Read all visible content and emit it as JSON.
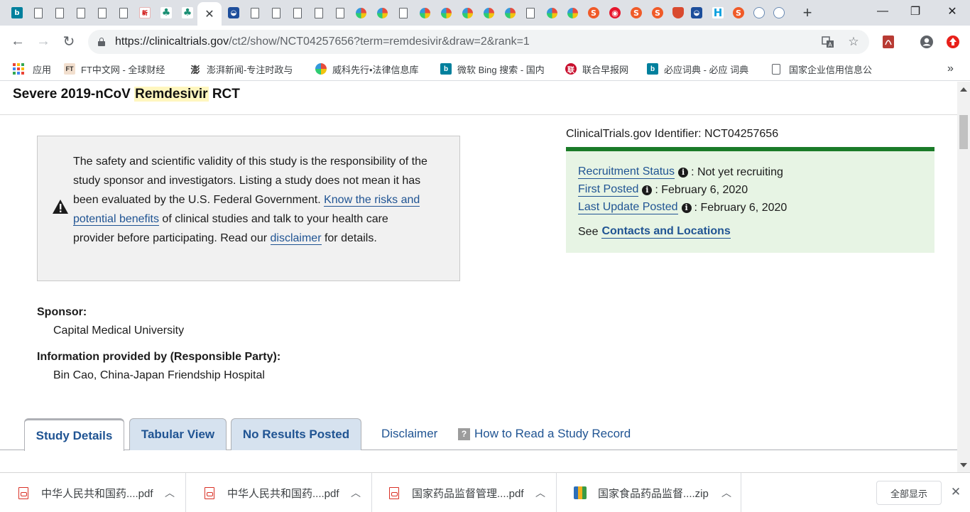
{
  "browser": {
    "tab_icons": [
      "bing-icon",
      "doc-icon",
      "doc-icon",
      "doc-icon",
      "doc-icon",
      "doc-icon",
      "news-icon",
      "teal-leaf-icon",
      "teal-leaf-icon",
      "ct-gov-icon",
      "doc-icon",
      "doc-icon",
      "doc-icon",
      "doc-icon",
      "doc-icon",
      "wheel-icon",
      "wheel-icon",
      "doc-icon",
      "wheel-icon",
      "wheel-icon",
      "wheel-icon",
      "wheel-icon",
      "wheel-icon",
      "doc-icon",
      "wheel-icon",
      "wheel-icon",
      "sogou-icon",
      "weibo-icon",
      "sogou-icon",
      "sogou-icon",
      "shield-icon",
      "ct-gov-icon",
      "hui-icon",
      "sogou-icon",
      "eye-icon",
      "eye-icon"
    ],
    "active_tab_close": "✕",
    "new_tab": "+",
    "window_controls": {
      "minimize": "—",
      "restore": "❐",
      "close": "✕"
    },
    "url_host": "https://clinicaltrials.gov",
    "url_path": "/ct2/show/NCT04257656?term=remdesivir&draw=2&rank=1"
  },
  "bookmarks": [
    {
      "label": "应用",
      "icon": "apps-icon"
    },
    {
      "label": "FT中文网 - 全球财经",
      "icon": "ft-icon"
    },
    {
      "label": "澎湃新闻-专注时政与",
      "icon": "thepaper-icon"
    },
    {
      "label": "威科先行•法律信息库",
      "icon": "wheel-icon"
    },
    {
      "label": "微软 Bing 搜索 - 国内",
      "icon": "bing-icon"
    },
    {
      "label": "联合早报网",
      "icon": "zaobao-icon"
    },
    {
      "label": "必应词典 - 必应 词典",
      "icon": "bing-icon"
    },
    {
      "label": "国家企业信用信息公",
      "icon": "doc-icon"
    }
  ],
  "bookmarks_overflow": "»",
  "page": {
    "title_pre": "Severe 2019-nCoV ",
    "title_highlight": "Remdesivir",
    "title_post": " RCT",
    "notice": {
      "text1": "The safety and scientific validity of this study is the responsibility of the study sponsor and investigators. Listing a study does not mean it has been evaluated by the U.S. Federal Government. ",
      "link1": "Know the risks and potential benefits",
      "text2": " of clinical studies and talk to your health care provider before participating. Read our ",
      "link2": "disclaimer",
      "text3": " for details."
    },
    "identifier": "ClinicalTrials.gov Identifier: NCT04257656",
    "status": {
      "recruitment_label": "Recruitment Status",
      "recruitment_value": ": Not yet recruiting",
      "first_posted_label": "First Posted",
      "first_posted_value": ": February 6, 2020",
      "last_update_label": "Last Update Posted",
      "last_update_value": ": February 6, 2020",
      "see_text": "See",
      "contacts_link": "Contacts and Locations"
    },
    "sponsor_label": "Sponsor:",
    "sponsor_value": "Capital Medical University",
    "responsible_label": "Information provided by (Responsible Party):",
    "responsible_value": "Bin Cao, China-Japan Friendship Hospital",
    "tabs": [
      "Study Details",
      "Tabular View",
      "No Results Posted"
    ],
    "disclaimer_link": "Disclaimer",
    "how_to_read_link": "How to Read a Study Record"
  },
  "downloads": {
    "items": [
      {
        "name": "中华人民共和国药....pdf",
        "type": "pdf"
      },
      {
        "name": "中华人民共和国药....pdf",
        "type": "pdf"
      },
      {
        "name": "国家药品监督管理....pdf",
        "type": "pdf"
      },
      {
        "name": "国家食品药品监督....zip",
        "type": "zip"
      }
    ],
    "show_all": "全部显示",
    "close": "✕"
  }
}
